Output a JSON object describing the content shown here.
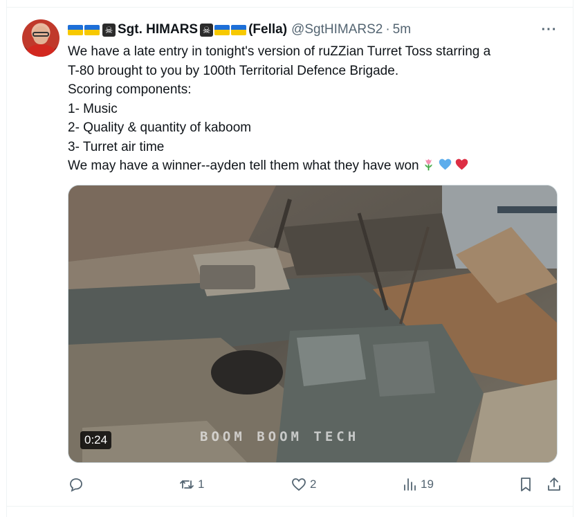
{
  "tweet": {
    "author": {
      "name_text": "Sgt. HIMARS",
      "name_suffix": "(Fella)",
      "handle": "@SgtHIMARS2",
      "separator": "·",
      "time": "5m"
    },
    "text_lines": [
      "We have a late entry in tonight's version of ruZZian Turret Toss starring a",
      "T-80 brought to you by 100th Territorial Defence Brigade.",
      "Scoring components:",
      "1- Music",
      "2- Quality & quantity of kaboom",
      "3- Turret air time",
      "We may have a winner--ayden tell them what they have won"
    ],
    "emojis": [
      "tulip",
      "blue-heart",
      "red-heart"
    ],
    "media": {
      "duration": "0:24",
      "watermark": "BOOM BOOM TECH"
    },
    "stats": {
      "replies": "",
      "reposts": "1",
      "likes": "2",
      "views": "19"
    },
    "icons": [
      "reply-icon",
      "repost-icon",
      "like-icon",
      "views-icon",
      "bookmark-icon",
      "share-icon",
      "more-icon"
    ],
    "colors": {
      "text": "#0f1419",
      "secondary": "#536471",
      "flag_blue": "#1d6fd8",
      "flag_yellow": "#f7c900"
    }
  }
}
